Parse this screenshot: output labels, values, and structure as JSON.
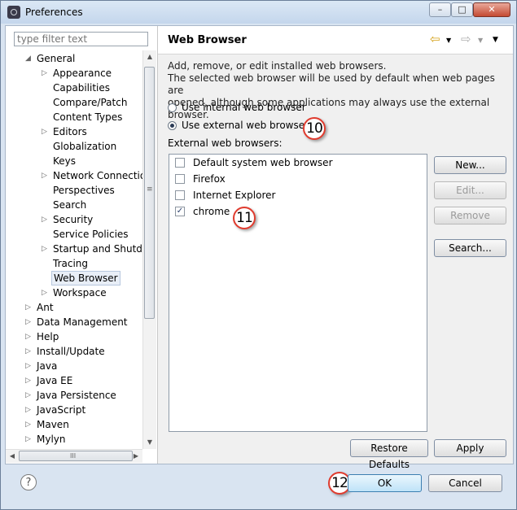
{
  "window": {
    "title": "Preferences",
    "controls": [
      "–",
      "□",
      "✕"
    ]
  },
  "sidebar": {
    "filter_placeholder": "type filter text",
    "tree": [
      {
        "label": "General",
        "arrow": "◢"
      },
      {
        "label": "Appearance",
        "arrow": "▷"
      },
      {
        "label": "Capabilities",
        "arrow": ""
      },
      {
        "label": "Compare/Patch",
        "arrow": ""
      },
      {
        "label": "Content Types",
        "arrow": ""
      },
      {
        "label": "Editors",
        "arrow": "▷"
      },
      {
        "label": "Globalization",
        "arrow": ""
      },
      {
        "label": "Keys",
        "arrow": ""
      },
      {
        "label": "Network Connection",
        "arrow": "▷"
      },
      {
        "label": "Perspectives",
        "arrow": ""
      },
      {
        "label": "Search",
        "arrow": ""
      },
      {
        "label": "Security",
        "arrow": "▷"
      },
      {
        "label": "Service Policies",
        "arrow": ""
      },
      {
        "label": "Startup and Shutdo",
        "arrow": "▷"
      },
      {
        "label": "Tracing",
        "arrow": ""
      },
      {
        "label": "Web Browser",
        "arrow": ""
      },
      {
        "label": "Workspace",
        "arrow": "▷"
      },
      {
        "label": "Ant",
        "arrow": "▷"
      },
      {
        "label": "Data Management",
        "arrow": "▷"
      },
      {
        "label": "Help",
        "arrow": "▷"
      },
      {
        "label": "Install/Update",
        "arrow": "▷"
      },
      {
        "label": "Java",
        "arrow": "▷"
      },
      {
        "label": "Java EE",
        "arrow": "▷"
      },
      {
        "label": "Java Persistence",
        "arrow": "▷"
      },
      {
        "label": "JavaScript",
        "arrow": "▷"
      },
      {
        "label": "Maven",
        "arrow": "▷"
      },
      {
        "label": "Mylyn",
        "arrow": "▷"
      }
    ],
    "selected": "Web Browser",
    "scroll_grip": "≡",
    "hscroll_grip": "III",
    "scroll_up": "▲",
    "scroll_down": "▼",
    "scroll_left": "◀",
    "scroll_right": "▶"
  },
  "page": {
    "title": "Web Browser",
    "nav": {
      "back": "⇦",
      "back_menu": "▼",
      "forward": "⇨",
      "forward_menu": "▼",
      "view_menu": "▼"
    },
    "description": [
      "Add, remove, or edit installed web browsers.",
      "The selected web browser will be used by default when web pages are",
      "opened, although some applications may always use the external browser."
    ],
    "radio_internal": "Use internal web browser",
    "radio_external": "Use external web browser",
    "external_label": "External web browsers:",
    "browsers": [
      {
        "label": "Default system web browser",
        "checked": ""
      },
      {
        "label": "Firefox",
        "checked": ""
      },
      {
        "label": "Internet Explorer",
        "checked": ""
      },
      {
        "label": "chrome",
        "checked": "✓"
      }
    ],
    "buttons": {
      "new": "New...",
      "edit": "Edit...",
      "remove": "Remove",
      "search": "Search...",
      "restore": "Restore Defaults",
      "apply": "Apply"
    }
  },
  "footer": {
    "help": "?",
    "ok": "OK",
    "cancel": "Cancel"
  },
  "annotations": {
    "b10": "10",
    "b11": "11",
    "b12": "12"
  }
}
